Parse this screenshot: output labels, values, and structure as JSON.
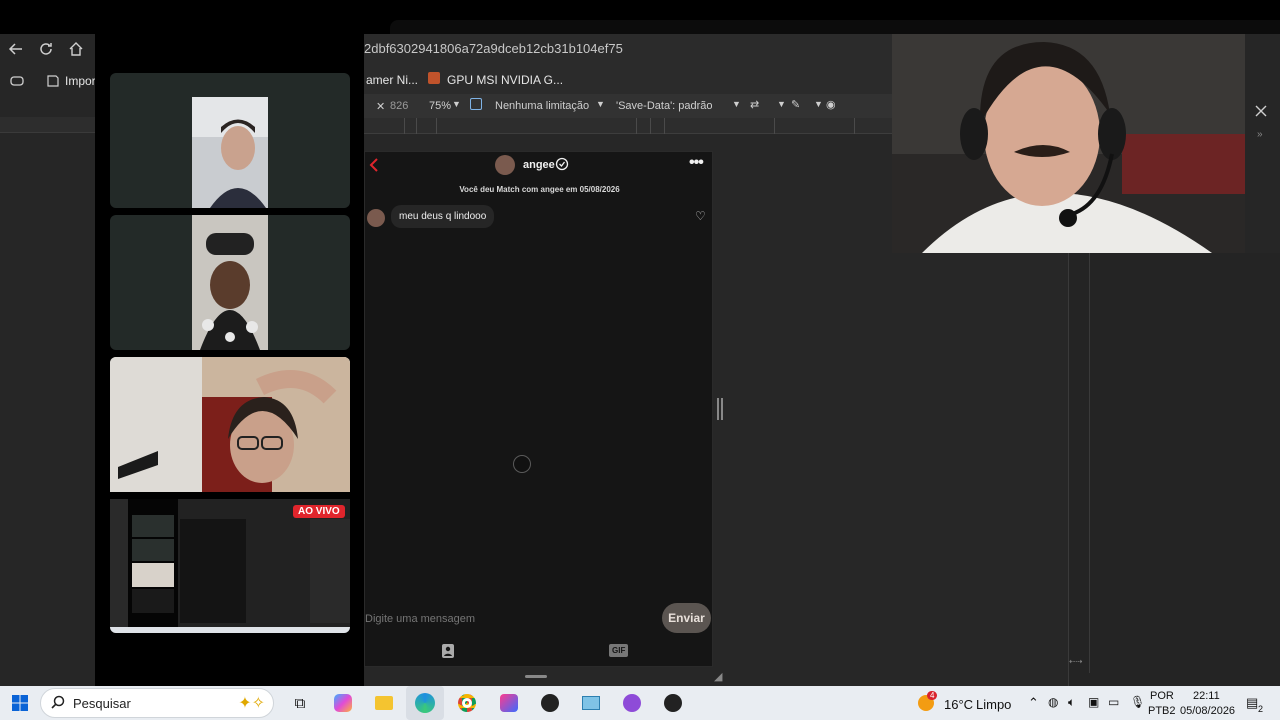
{
  "browser": {
    "url": "2dbf6302941806a72a9dceb12cb31b104ef75",
    "favorites_label": "Import",
    "bookmarks": [
      "amer Ni...",
      "GPU MSI NVIDIA G..."
    ],
    "devtools_bar": {
      "height_value": "826",
      "zoom": "75%",
      "throttle": "Nenhuma limitação",
      "save_data": "'Save-Data': padrão"
    }
  },
  "call": {
    "live_badge": "AO VIVO"
  },
  "app": {
    "contact_name": "angee",
    "match_text": "Você deu Match com angee em 05/08/2026",
    "message": "meu deus q lindooo",
    "composer_placeholder": "Digite uma mensagem",
    "send_label": "Enviar",
    "gif_label": "GIF"
  },
  "taskbar": {
    "search_placeholder": "Pesquisar",
    "weather_temp": "16°C",
    "weather_desc": "Limpo",
    "weather_badge": "4",
    "lang_top": "POR",
    "lang_bottom": "PTB2",
    "time": "22:11",
    "date": "05/08/2026",
    "notif_count": "2"
  },
  "colors": {
    "send_bg": "#5b5551",
    "live_badge": "#e0252c",
    "back_arrow": "#e0252c",
    "taskbar": "#e9edf2"
  },
  "icons": [
    "back-arrow-icon",
    "refresh-icon",
    "home-icon",
    "favorites-icon",
    "heart-icon",
    "contact-card-icon",
    "gif-icon",
    "windows-icon",
    "search-icon",
    "task-view-icon",
    "close-icon"
  ]
}
